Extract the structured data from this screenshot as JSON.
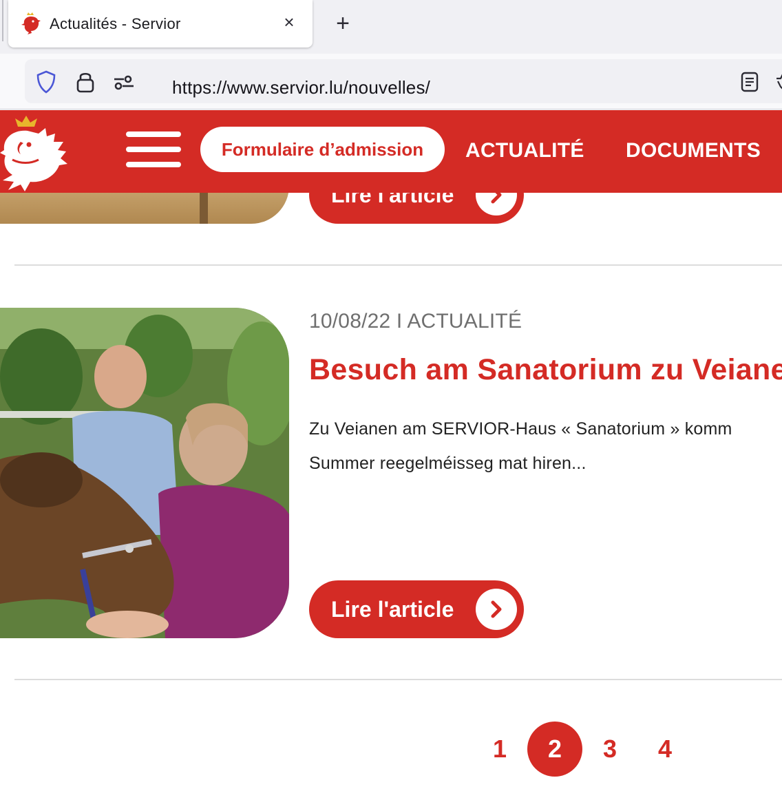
{
  "browser": {
    "tab_title": "Actualités - Servior",
    "tab_close": "×",
    "new_tab": "+",
    "url": "https://www.servior.lu/nouvelles/"
  },
  "header": {
    "admission_label": "Formulaire d’admission",
    "nav": [
      "ACTUALITÉ",
      "DOCUMENTS"
    ]
  },
  "articles": [
    {
      "read_label": "Lire l'article"
    },
    {
      "meta": "10/08/22 I ACTUALITÉ",
      "title": "Besuch am Sanatorium zu Veiane",
      "excerpt_line1": "Zu Veianen am SERVIOR-Haus « Sanatorium » komm",
      "excerpt_line2": "Summer reegelméisseg mat hiren...",
      "read_label": "Lire l'article"
    }
  ],
  "pagination": {
    "pages": [
      "1",
      "2",
      "3",
      "4"
    ],
    "current": "2"
  },
  "colors": {
    "brand_red": "#d42b25",
    "text_grey": "#6f6f6f"
  }
}
